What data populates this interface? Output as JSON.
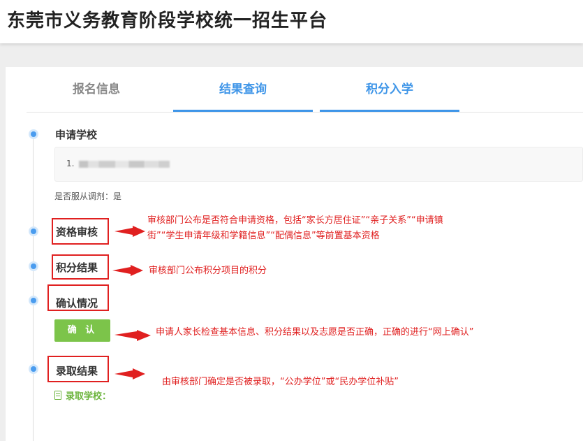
{
  "header": {
    "title": "东莞市义务教育阶段学校统一招生平台"
  },
  "tabs": [
    {
      "label": "报名信息"
    },
    {
      "label": "结果查询"
    },
    {
      "label": "积分入学"
    }
  ],
  "timeline": {
    "apply_school": {
      "label": "申请学校",
      "school_item": "1. ",
      "adjust_text": "是否服从调剂：是"
    },
    "review": {
      "label": "资格审核"
    },
    "points": {
      "label": "积分结果"
    },
    "confirm": {
      "label": "确认情况",
      "button": "确 认"
    },
    "admission": {
      "label": "录取结果",
      "school_label": "录取学校："
    }
  },
  "annotations": {
    "review_line1": "审核部门公布是否符合申请资格，包括“家长方居住证”“亲子关系”“申请镇",
    "review_line2": "街”“学生申请年级和学籍信息”“配偶信息”等前置基本资格",
    "points": "审核部门公布积分项目的积分",
    "confirm": "申请人家长检查基本信息、积分结果以及志愿是否正确，正确的进行“网上确认”",
    "admission": "由审核部门确定是否被录取，“公办学位”或“民办学位补贴”"
  },
  "colors": {
    "accent": "#3e95e8",
    "annotation": "#e02020",
    "confirm_button": "#7cc44a"
  }
}
